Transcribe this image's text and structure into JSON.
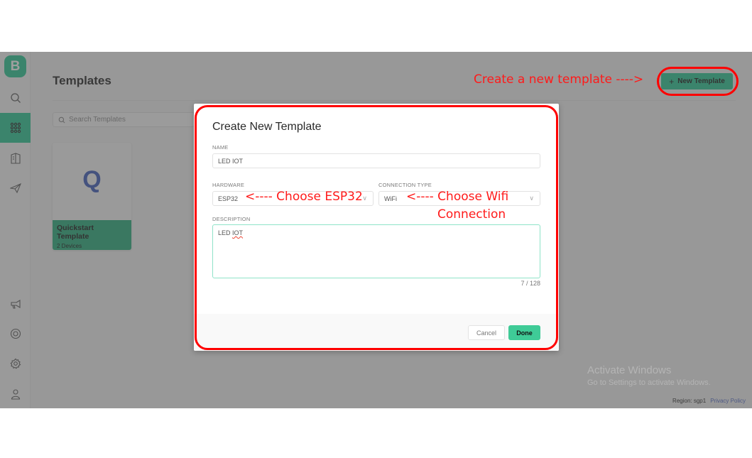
{
  "sidebar": {
    "logo_letter": "B",
    "items": [
      {
        "icon": "search-icon",
        "active": false
      },
      {
        "icon": "templates-grid-icon",
        "active": true
      },
      {
        "icon": "book-icon",
        "active": false
      },
      {
        "icon": "send-icon",
        "active": false
      },
      {
        "icon": "megaphone-icon",
        "active": false
      },
      {
        "icon": "lifebuoy-icon",
        "active": false
      },
      {
        "icon": "gear-icon",
        "active": false
      },
      {
        "icon": "user-icon",
        "active": false
      }
    ]
  },
  "header": {
    "title": "Templates",
    "new_template_label": "New Template",
    "new_template_plus": "+"
  },
  "search": {
    "placeholder": "Search Templates"
  },
  "templates": [
    {
      "letter": "Q",
      "name": "Quickstart Template",
      "devices": "2 Devices"
    }
  ],
  "footer": {
    "region": "Region: sgp1",
    "privacy": "Privacy Policy"
  },
  "watermark": {
    "line1": "Activate Windows",
    "line2": "Go to Settings to activate Windows."
  },
  "modal": {
    "title": "Create New Template",
    "name_label": "NAME",
    "name_value": "LED IOT",
    "hardware_label": "HARDWARE",
    "hardware_value": "ESP32",
    "connection_label": "CONNECTION TYPE",
    "connection_value": "WiFi",
    "description_label": "DESCRIPTION",
    "description_word1": "LED ",
    "description_word2": "IOT",
    "counter": "7 / 128",
    "cancel_label": "Cancel",
    "done_label": "Done"
  },
  "annotations": {
    "new_template": "Create a new template  ---->",
    "hardware": "<---- Choose ESP32",
    "connection_line1": "<---- Choose Wifi",
    "connection_line2": "Connection"
  },
  "colors": {
    "brand": "#23c48e",
    "annotation": "#ff0000"
  }
}
